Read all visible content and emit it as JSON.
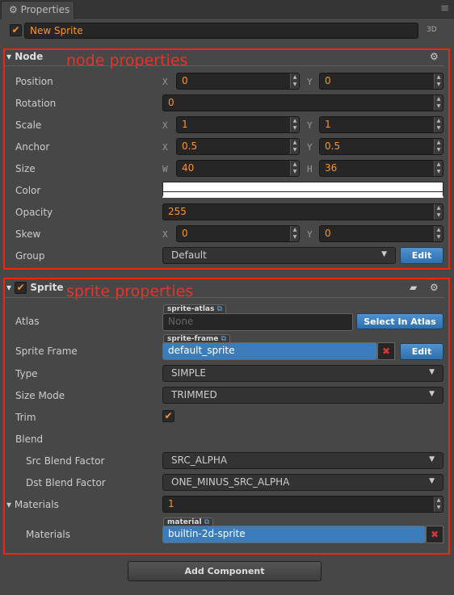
{
  "tab": {
    "icon": "gear-icon",
    "title": "Properties",
    "menu_icon": "hamburger-icon"
  },
  "node_name": {
    "enabled": true,
    "value": "New Sprite",
    "badge": "3D"
  },
  "accent": "#fd942b",
  "annotations": {
    "node": "node properties",
    "sprite": "sprite properties",
    "color": "#f2260a"
  },
  "node": {
    "title": "Node",
    "rows": {
      "position": {
        "label": "Position",
        "ax1": "X",
        "v1": "0",
        "ax2": "Y",
        "v2": "0"
      },
      "rotation": {
        "label": "Rotation",
        "v": "0"
      },
      "scale": {
        "label": "Scale",
        "ax1": "X",
        "v1": "1",
        "ax2": "Y",
        "v2": "1"
      },
      "anchor": {
        "label": "Anchor",
        "ax1": "X",
        "v1": "0.5",
        "ax2": "Y",
        "v2": "0.5"
      },
      "size": {
        "label": "Size",
        "ax1": "W",
        "v1": "40",
        "ax2": "H",
        "v2": "36"
      },
      "color": {
        "label": "Color",
        "value": "#ffffff"
      },
      "opacity": {
        "label": "Opacity",
        "v": "255"
      },
      "skew": {
        "label": "Skew",
        "ax1": "X",
        "v1": "0",
        "ax2": "Y",
        "v2": "0"
      },
      "group": {
        "label": "Group",
        "value": "Default",
        "edit": "Edit"
      }
    }
  },
  "sprite": {
    "title": "Sprite",
    "enabled": true,
    "atlas": {
      "label": "Atlas",
      "tag": "sprite-atlas",
      "value": "None",
      "button": "Select In Atlas"
    },
    "frame": {
      "label": "Sprite Frame",
      "tag": "sprite-frame",
      "value": "default_sprite",
      "edit": "Edit"
    },
    "type": {
      "label": "Type",
      "value": "SIMPLE"
    },
    "size_mode": {
      "label": "Size Mode",
      "value": "TRIMMED"
    },
    "trim": {
      "label": "Trim",
      "checked": true
    },
    "blend": {
      "label": "Blend"
    },
    "src": {
      "label": "Src Blend Factor",
      "value": "SRC_ALPHA"
    },
    "dst": {
      "label": "Dst Blend Factor",
      "value": "ONE_MINUS_SRC_ALPHA"
    },
    "materials": {
      "label": "Materials",
      "count": "1",
      "item_label": "Materials",
      "tag": "material",
      "value": "builtin-2d-sprite"
    }
  },
  "add_component": "Add Component"
}
